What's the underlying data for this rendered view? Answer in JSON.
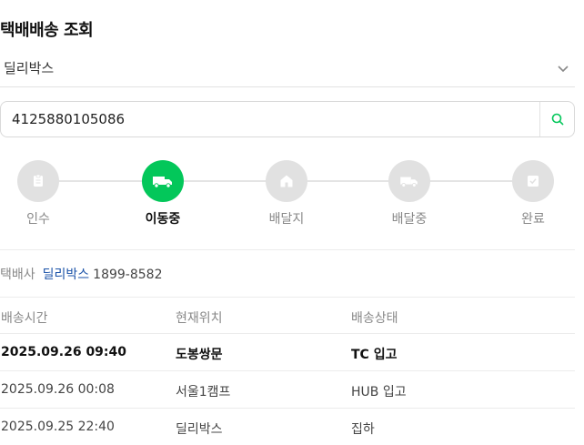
{
  "title": "택배배송 조회",
  "carrier_select": {
    "value": "딜리박스"
  },
  "search": {
    "value": "4125880105086"
  },
  "steps": [
    {
      "label": "인수",
      "icon": "document-icon",
      "active": false
    },
    {
      "label": "이동중",
      "icon": "truck-icon",
      "active": true
    },
    {
      "label": "배달지",
      "icon": "house-icon",
      "active": false
    },
    {
      "label": "배달중",
      "icon": "truck-icon",
      "active": false
    },
    {
      "label": "완료",
      "icon": "check-icon",
      "active": false
    }
  ],
  "carrier_info": {
    "label": "택배사",
    "name": "딜리박스",
    "phone": "1899-8582"
  },
  "table": {
    "headers": [
      "배송시간",
      "현재위치",
      "배송상태"
    ],
    "rows": [
      {
        "time": "2025.09.26 09:40",
        "location": "도봉쌍문",
        "status": "TC 입고"
      },
      {
        "time": "2025.09.26 00:08",
        "location": "서울1캠프",
        "status": "HUB 입고"
      },
      {
        "time": "2025.09.25 22:40",
        "location": "딜리박스",
        "status": "집하"
      }
    ]
  },
  "colors": {
    "accent": "#03c75a",
    "link": "#1a52a8",
    "inactive": "#e1e1e1"
  }
}
